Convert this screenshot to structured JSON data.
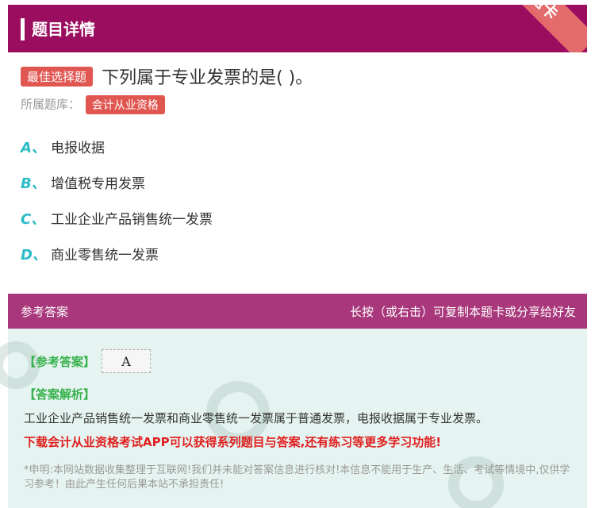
{
  "header": {
    "title": "题目详情",
    "ribbon": "题卡"
  },
  "question": {
    "type_tag": "最佳选择题",
    "text": "下列属于专业发票的是( )。"
  },
  "meta": {
    "label": "所属题库：",
    "bank_tag": "会计从业资格"
  },
  "options": [
    {
      "letter": "A、",
      "text": "电报收据"
    },
    {
      "letter": "B、",
      "text": "增值税专用发票"
    },
    {
      "letter": "C、",
      "text": "工业企业产品销售统一发票"
    },
    {
      "letter": "D、",
      "text": "商业零售统一发票"
    }
  ],
  "answer": {
    "head_left": "参考答案",
    "head_right": "长按（或右击）可复制本题卡或分享给好友",
    "answer_label": "【参考答案】",
    "answer_value": "A",
    "analysis_label": "【答案解析】",
    "analysis_text": "工业企业产品销售统一发票和商业零售统一发票属于普通发票，电报收据属于专业发票。",
    "promo": "下载会计从业资格考试APP可以获得系列题目与答案,还有练习等更多学习功能!",
    "disclaimer": "*申明:本网站数据收集整理于互联网!我们并未能对答案信息进行核对!本信息不能用于生产、生活、考试等情境中,仅供学习参考！由此产生任何后果本站不承担责任!"
  },
  "colors": {
    "header_bg": "#9b0d5f",
    "answer_head_bg": "#a8377b",
    "answer_bg": "#e6f4f1",
    "tag_red": "#e05752",
    "option_letter": "#2cbcc8",
    "green_label": "#37b24d",
    "promo_red": "#e02020"
  }
}
